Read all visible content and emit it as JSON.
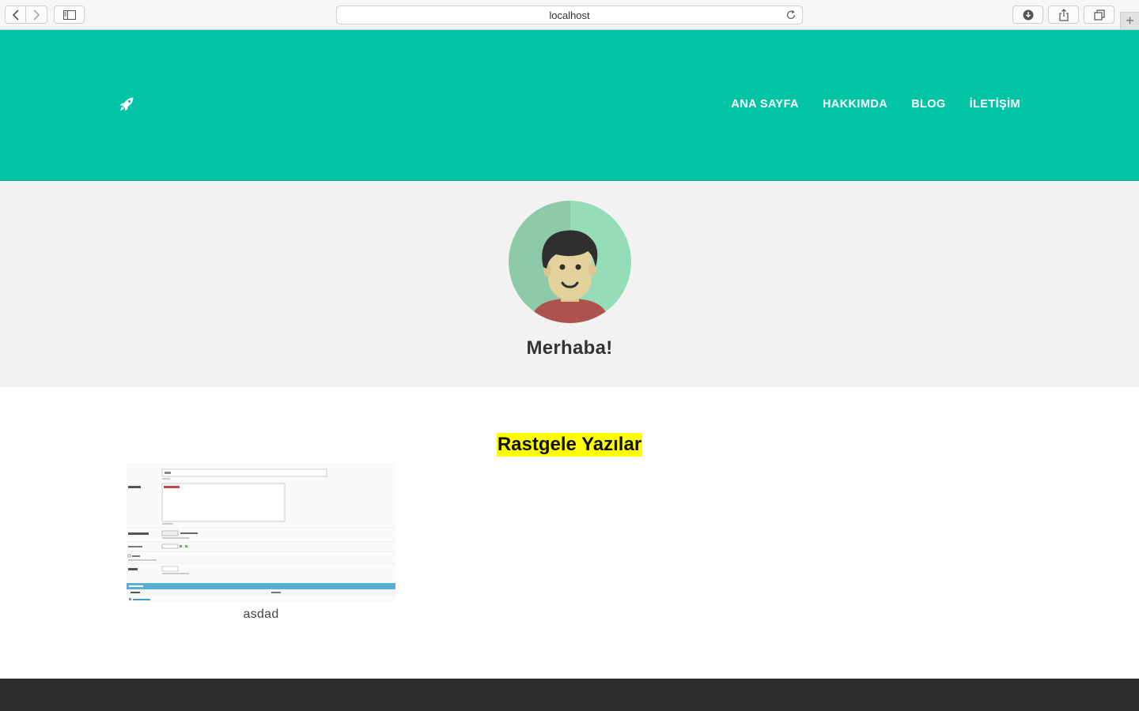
{
  "browser": {
    "url": "localhost"
  },
  "header": {
    "logo_icon": "rocket-icon",
    "menu": [
      {
        "label": "ANA SAYFA"
      },
      {
        "label": "HAKKIMDA"
      },
      {
        "label": "BLOG"
      },
      {
        "label": "İLETİŞİM"
      }
    ],
    "bg_color": "#00c4a3"
  },
  "hero": {
    "title": "Merhaba!"
  },
  "main": {
    "section_title": "Rastgele Yazılar",
    "highlight_color": "#ffff00",
    "posts": [
      {
        "title": "asdad"
      }
    ]
  }
}
